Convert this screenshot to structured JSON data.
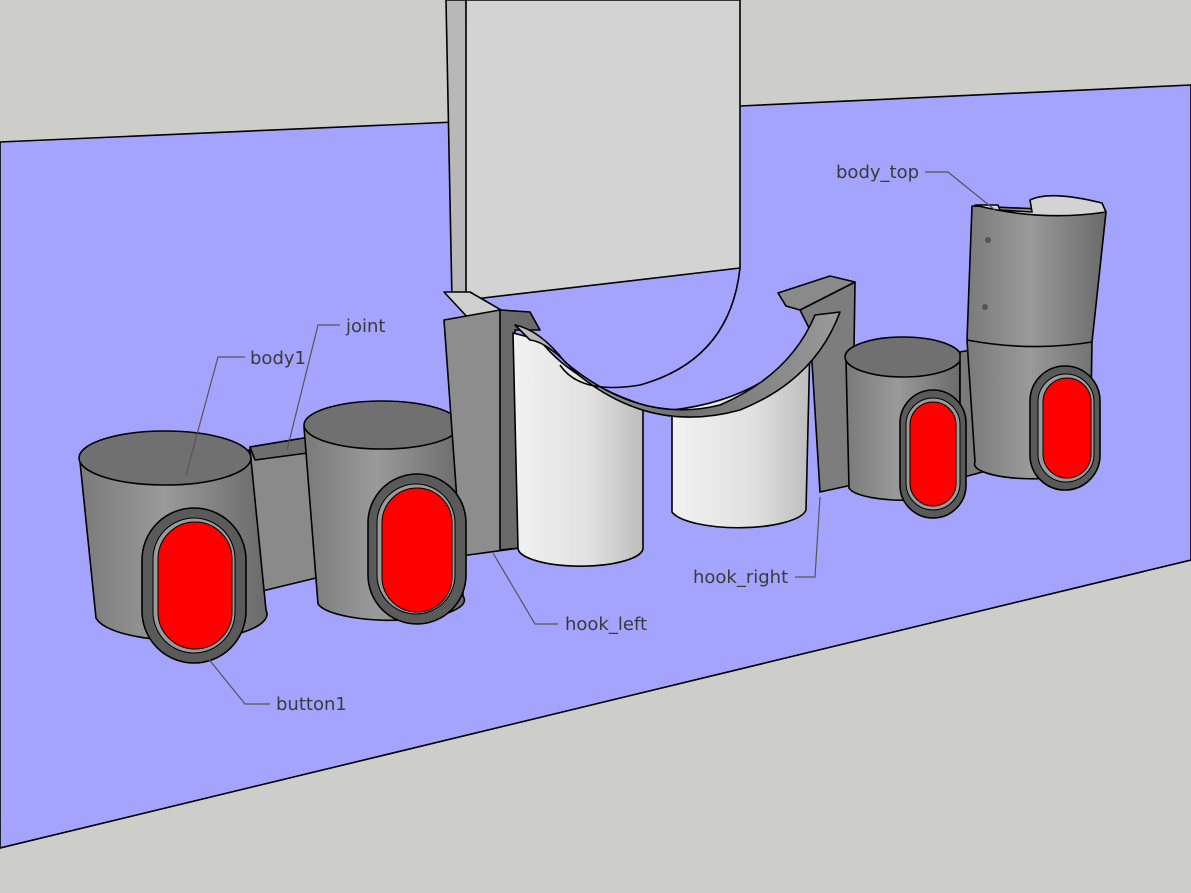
{
  "colors": {
    "background": "#cdcdc9",
    "wall": "#a4a4fe",
    "vacuum_tube": "#d3d3d3",
    "body_side": "#8e8e8e",
    "body_top": "#707070",
    "hook_white": "#e8e8e8",
    "button_red": "#ff0000",
    "label_text": "#3a3a3a"
  },
  "labels": {
    "body1": "body1",
    "joint": "joint",
    "body_top": "body_top",
    "hook_left": "hook_left",
    "hook_right": "hook_right",
    "button1": "button1"
  }
}
